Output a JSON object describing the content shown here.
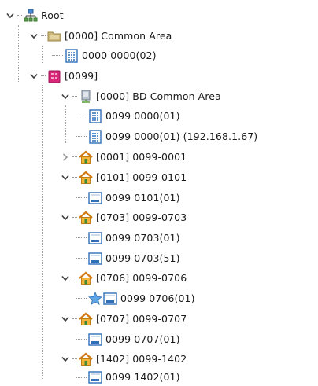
{
  "tree": {
    "root": {
      "label": "Root"
    },
    "common_area": {
      "label": "[0000] Common Area"
    },
    "common_area_device": {
      "label": "0000 0000(02)"
    },
    "building_0099": {
      "label": "[0099]"
    },
    "bd_common_area": {
      "label": "[0000] BD Common Area"
    },
    "bd_device_1": {
      "label": "0099 0000(01)"
    },
    "bd_device_2": {
      "label": "0099 0000(01) (192.168.1.67)"
    },
    "unit_0001": {
      "label": "[0001] 0099-0001"
    },
    "unit_0101": {
      "label": "[0101] 0099-0101"
    },
    "unit_0101_device": {
      "label": "0099 0101(01)"
    },
    "unit_0703": {
      "label": "[0703] 0099-0703"
    },
    "unit_0703_device_1": {
      "label": "0099 0703(01)"
    },
    "unit_0703_device_2": {
      "label": "0099 0703(51)"
    },
    "unit_0706": {
      "label": "[0706] 0099-0706"
    },
    "unit_0706_device": {
      "label": "0099 0706(01)"
    },
    "unit_0707": {
      "label": "[0707] 0099-0707"
    },
    "unit_0707_device": {
      "label": "0099 0707(01)"
    },
    "unit_1402": {
      "label": "[1402] 0099-1402"
    },
    "unit_1402_device": {
      "label": "0099 1402(01)"
    }
  },
  "icons": {
    "network": "network-icon",
    "folder": "folder-icon",
    "building": "building-icon",
    "server": "server-icon",
    "house": "house-icon",
    "list_device": "list-device-icon",
    "screen_device": "screen-device-icon",
    "star": "star-icon"
  }
}
